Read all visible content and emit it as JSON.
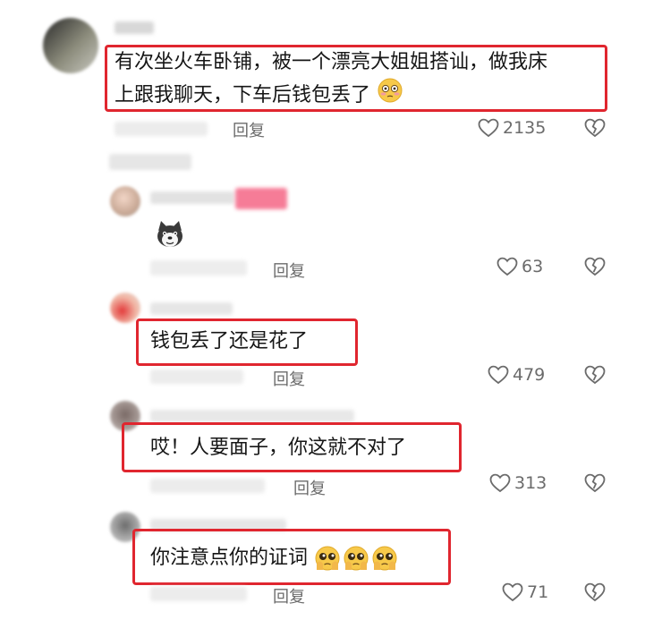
{
  "comments": [
    {
      "text_line1": "有次坐火车卧铺，被一个漂亮大姐姐搭讪，做我床",
      "text_line2": "上跟我聊天，下车后钱包丢了",
      "reply_label": "回复",
      "likes": "2135",
      "emoji_icon": "flushed-face-icon"
    },
    {
      "reply_label": "回复",
      "likes": "63",
      "sticker_icon": "dog-face-sticker-icon"
    },
    {
      "text": "钱包丢了还是花了",
      "reply_label": "回复",
      "likes": "479"
    },
    {
      "text": "哎！人要面子，你这就不对了",
      "reply_label": "回复",
      "likes": "313"
    },
    {
      "text": "你注意点你的证词",
      "reply_label": "回复",
      "likes": "71",
      "emoji_icon": "pleading-face-icon"
    }
  ],
  "colors": {
    "highlight": "#e0262f",
    "text": "#161616",
    "meta": "#6b6b6b"
  }
}
